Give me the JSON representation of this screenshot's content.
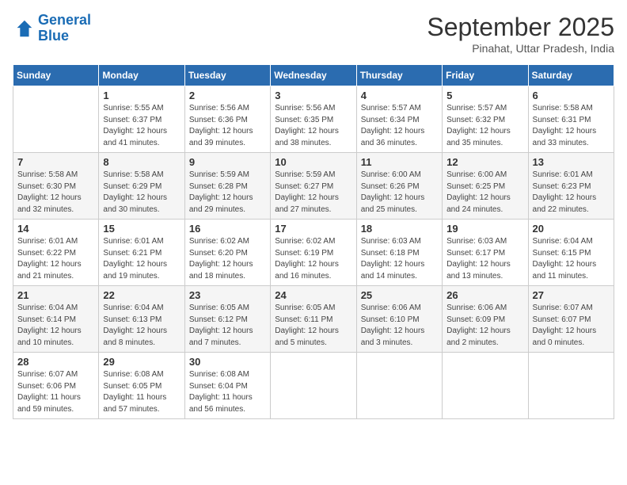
{
  "header": {
    "logo_line1": "General",
    "logo_line2": "Blue",
    "month": "September 2025",
    "location": "Pinahat, Uttar Pradesh, India"
  },
  "days_of_week": [
    "Sunday",
    "Monday",
    "Tuesday",
    "Wednesday",
    "Thursday",
    "Friday",
    "Saturday"
  ],
  "weeks": [
    [
      {
        "day": "",
        "info": ""
      },
      {
        "day": "1",
        "info": "Sunrise: 5:55 AM\nSunset: 6:37 PM\nDaylight: 12 hours\nand 41 minutes."
      },
      {
        "day": "2",
        "info": "Sunrise: 5:56 AM\nSunset: 6:36 PM\nDaylight: 12 hours\nand 39 minutes."
      },
      {
        "day": "3",
        "info": "Sunrise: 5:56 AM\nSunset: 6:35 PM\nDaylight: 12 hours\nand 38 minutes."
      },
      {
        "day": "4",
        "info": "Sunrise: 5:57 AM\nSunset: 6:34 PM\nDaylight: 12 hours\nand 36 minutes."
      },
      {
        "day": "5",
        "info": "Sunrise: 5:57 AM\nSunset: 6:32 PM\nDaylight: 12 hours\nand 35 minutes."
      },
      {
        "day": "6",
        "info": "Sunrise: 5:58 AM\nSunset: 6:31 PM\nDaylight: 12 hours\nand 33 minutes."
      }
    ],
    [
      {
        "day": "7",
        "info": "Sunrise: 5:58 AM\nSunset: 6:30 PM\nDaylight: 12 hours\nand 32 minutes."
      },
      {
        "day": "8",
        "info": "Sunrise: 5:58 AM\nSunset: 6:29 PM\nDaylight: 12 hours\nand 30 minutes."
      },
      {
        "day": "9",
        "info": "Sunrise: 5:59 AM\nSunset: 6:28 PM\nDaylight: 12 hours\nand 29 minutes."
      },
      {
        "day": "10",
        "info": "Sunrise: 5:59 AM\nSunset: 6:27 PM\nDaylight: 12 hours\nand 27 minutes."
      },
      {
        "day": "11",
        "info": "Sunrise: 6:00 AM\nSunset: 6:26 PM\nDaylight: 12 hours\nand 25 minutes."
      },
      {
        "day": "12",
        "info": "Sunrise: 6:00 AM\nSunset: 6:25 PM\nDaylight: 12 hours\nand 24 minutes."
      },
      {
        "day": "13",
        "info": "Sunrise: 6:01 AM\nSunset: 6:23 PM\nDaylight: 12 hours\nand 22 minutes."
      }
    ],
    [
      {
        "day": "14",
        "info": "Sunrise: 6:01 AM\nSunset: 6:22 PM\nDaylight: 12 hours\nand 21 minutes."
      },
      {
        "day": "15",
        "info": "Sunrise: 6:01 AM\nSunset: 6:21 PM\nDaylight: 12 hours\nand 19 minutes."
      },
      {
        "day": "16",
        "info": "Sunrise: 6:02 AM\nSunset: 6:20 PM\nDaylight: 12 hours\nand 18 minutes."
      },
      {
        "day": "17",
        "info": "Sunrise: 6:02 AM\nSunset: 6:19 PM\nDaylight: 12 hours\nand 16 minutes."
      },
      {
        "day": "18",
        "info": "Sunrise: 6:03 AM\nSunset: 6:18 PM\nDaylight: 12 hours\nand 14 minutes."
      },
      {
        "day": "19",
        "info": "Sunrise: 6:03 AM\nSunset: 6:17 PM\nDaylight: 12 hours\nand 13 minutes."
      },
      {
        "day": "20",
        "info": "Sunrise: 6:04 AM\nSunset: 6:15 PM\nDaylight: 12 hours\nand 11 minutes."
      }
    ],
    [
      {
        "day": "21",
        "info": "Sunrise: 6:04 AM\nSunset: 6:14 PM\nDaylight: 12 hours\nand 10 minutes."
      },
      {
        "day": "22",
        "info": "Sunrise: 6:04 AM\nSunset: 6:13 PM\nDaylight: 12 hours\nand 8 minutes."
      },
      {
        "day": "23",
        "info": "Sunrise: 6:05 AM\nSunset: 6:12 PM\nDaylight: 12 hours\nand 7 minutes."
      },
      {
        "day": "24",
        "info": "Sunrise: 6:05 AM\nSunset: 6:11 PM\nDaylight: 12 hours\nand 5 minutes."
      },
      {
        "day": "25",
        "info": "Sunrise: 6:06 AM\nSunset: 6:10 PM\nDaylight: 12 hours\nand 3 minutes."
      },
      {
        "day": "26",
        "info": "Sunrise: 6:06 AM\nSunset: 6:09 PM\nDaylight: 12 hours\nand 2 minutes."
      },
      {
        "day": "27",
        "info": "Sunrise: 6:07 AM\nSunset: 6:07 PM\nDaylight: 12 hours\nand 0 minutes."
      }
    ],
    [
      {
        "day": "28",
        "info": "Sunrise: 6:07 AM\nSunset: 6:06 PM\nDaylight: 11 hours\nand 59 minutes."
      },
      {
        "day": "29",
        "info": "Sunrise: 6:08 AM\nSunset: 6:05 PM\nDaylight: 11 hours\nand 57 minutes."
      },
      {
        "day": "30",
        "info": "Sunrise: 6:08 AM\nSunset: 6:04 PM\nDaylight: 11 hours\nand 56 minutes."
      },
      {
        "day": "",
        "info": ""
      },
      {
        "day": "",
        "info": ""
      },
      {
        "day": "",
        "info": ""
      },
      {
        "day": "",
        "info": ""
      }
    ]
  ]
}
